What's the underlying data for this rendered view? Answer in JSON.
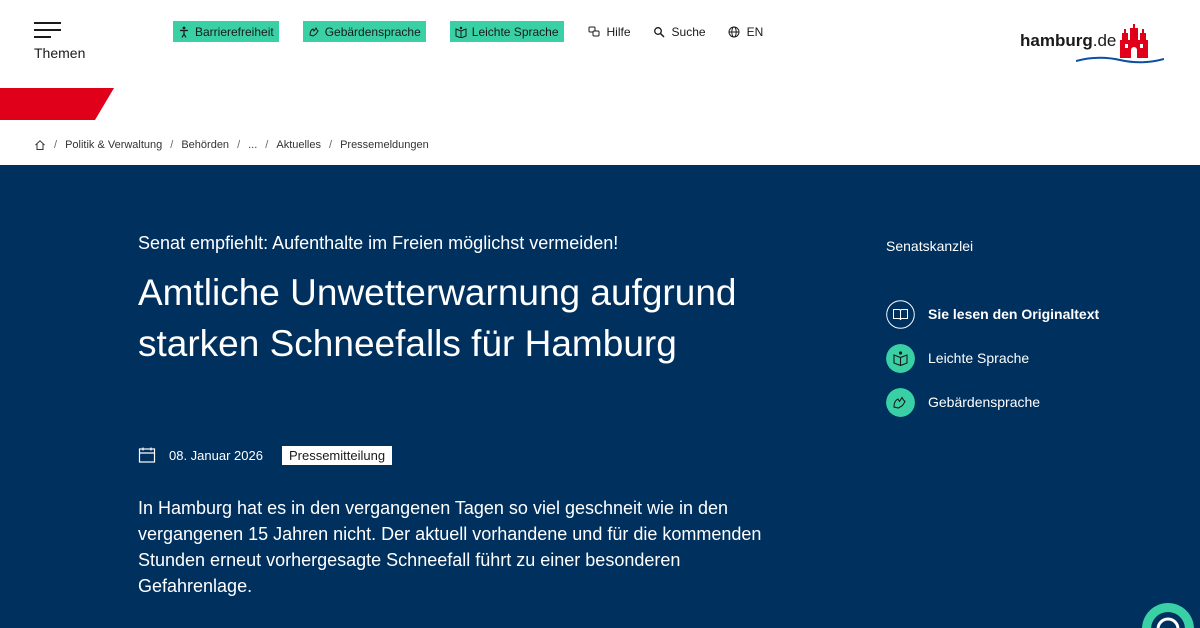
{
  "header": {
    "menu_label": "Themen",
    "toplinks": [
      {
        "label": "Barrierefreiheit",
        "icon": "accessibility-icon",
        "style": "pill"
      },
      {
        "label": "Gebärdensprache",
        "icon": "sign-language-icon",
        "style": "pill"
      },
      {
        "label": "Leichte Sprache",
        "icon": "easy-language-icon",
        "style": "pill"
      },
      {
        "label": "Hilfe",
        "icon": "help-icon",
        "style": "link"
      },
      {
        "label": "Suche",
        "icon": "search-icon",
        "style": "link"
      },
      {
        "label": "EN",
        "icon": "globe-icon",
        "style": "link"
      }
    ],
    "logo": {
      "brand_bold": "hamburg",
      "brand_suffix": ".de"
    }
  },
  "breadcrumb": [
    "Politik & Verwaltung",
    "Behörden",
    "...",
    "Aktuelles",
    "Pressemeldungen"
  ],
  "article": {
    "kicker": "Senat empfiehlt: Aufenthalte im Freien möglichst vermeiden!",
    "title": "Amtliche Unwetterwarnung aufgrund starken Schneefalls für Hamburg",
    "date": "08. Januar 2026",
    "type": "Pressemitteilung",
    "lead": "In Hamburg hat es in den vergangenen Tagen so viel geschneit wie in den vergangenen 15 Jahren nicht. Der aktuell vorhandene und für die kommenden Stunden erneut vorhergesagte Schneefall führt zu einer besonderen Gefahrenlage."
  },
  "sidebar": {
    "organization": "Senatskanzlei",
    "links": [
      {
        "label": "Sie lesen den Originaltext",
        "icon": "book-icon"
      },
      {
        "label": "Leichte Sprache",
        "icon": "easy-language-icon"
      },
      {
        "label": "Gebärdensprache",
        "icon": "sign-language-icon"
      }
    ]
  },
  "colors": {
    "navy": "#00305e",
    "accent_green": "#3ad0a6",
    "brand_red": "#e10019"
  }
}
